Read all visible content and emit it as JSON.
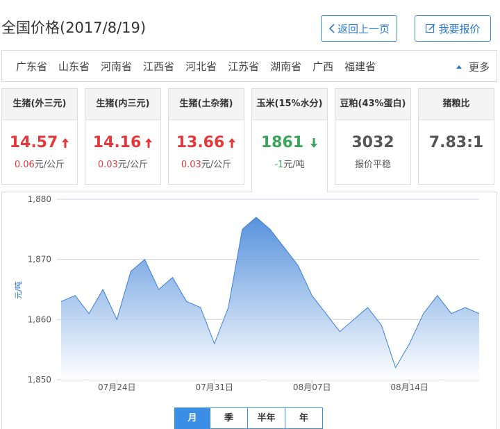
{
  "header": {
    "title": "全国价格(2017/8/19)",
    "back_label": "返回上一页",
    "quote_label": "我要报价"
  },
  "provinces": [
    "广东省",
    "山东省",
    "河南省",
    "江西省",
    "河北省",
    "江苏省",
    "湖南省",
    "广西",
    "福建省"
  ],
  "more_label": "更多",
  "cards": [
    {
      "name": "生猪(外三元)",
      "value": "14.57",
      "change": "0.06",
      "unit": "元/公斤",
      "trend": "up"
    },
    {
      "name": "生猪(内三元)",
      "value": "14.16",
      "change": "0.03",
      "unit": "元/公斤",
      "trend": "up"
    },
    {
      "name": "生猪(土杂猪)",
      "value": "13.66",
      "change": "0.03",
      "unit": "元/公斤",
      "trend": "up"
    },
    {
      "name": "玉米(15%水分)",
      "value": "1861",
      "change": "-1",
      "unit": "元/吨",
      "trend": "down"
    },
    {
      "name": "豆粕(43%蛋白)",
      "value": "3032",
      "change": "报价平稳",
      "unit": "",
      "trend": "flat"
    },
    {
      "name": "猪粮比",
      "value": "7.83:1",
      "change": "",
      "unit": "",
      "trend": "none"
    }
  ],
  "colors": {
    "up": "#e4393c",
    "down": "#3aa55a",
    "accent": "#3a8ee6",
    "area_top": "#3a7fd6",
    "area_bottom": "#ffffff"
  },
  "tabs": [
    {
      "label": "月",
      "active": true
    },
    {
      "label": "季",
      "active": false
    },
    {
      "label": "半年",
      "active": false
    },
    {
      "label": "年",
      "active": false
    }
  ],
  "chart_data": {
    "type": "area",
    "ylabel": "元/吨",
    "ylim": [
      1850,
      1880
    ],
    "yticks": [
      "1,850",
      "1,860",
      "1,870",
      "1,880"
    ],
    "xticks": [
      "07月24日",
      "07月31日",
      "08月07日",
      "08月14日"
    ],
    "series": [
      {
        "values": [
          1863,
          1864,
          1861,
          1865,
          1860,
          1868,
          1870,
          1865,
          1867,
          1863,
          1862,
          1856,
          1862,
          1875,
          1877,
          1875,
          1872,
          1869,
          1864,
          1861,
          1858,
          1860,
          1862,
          1859,
          1852,
          1856,
          1861,
          1864,
          1861,
          1862,
          1861
        ]
      }
    ]
  }
}
